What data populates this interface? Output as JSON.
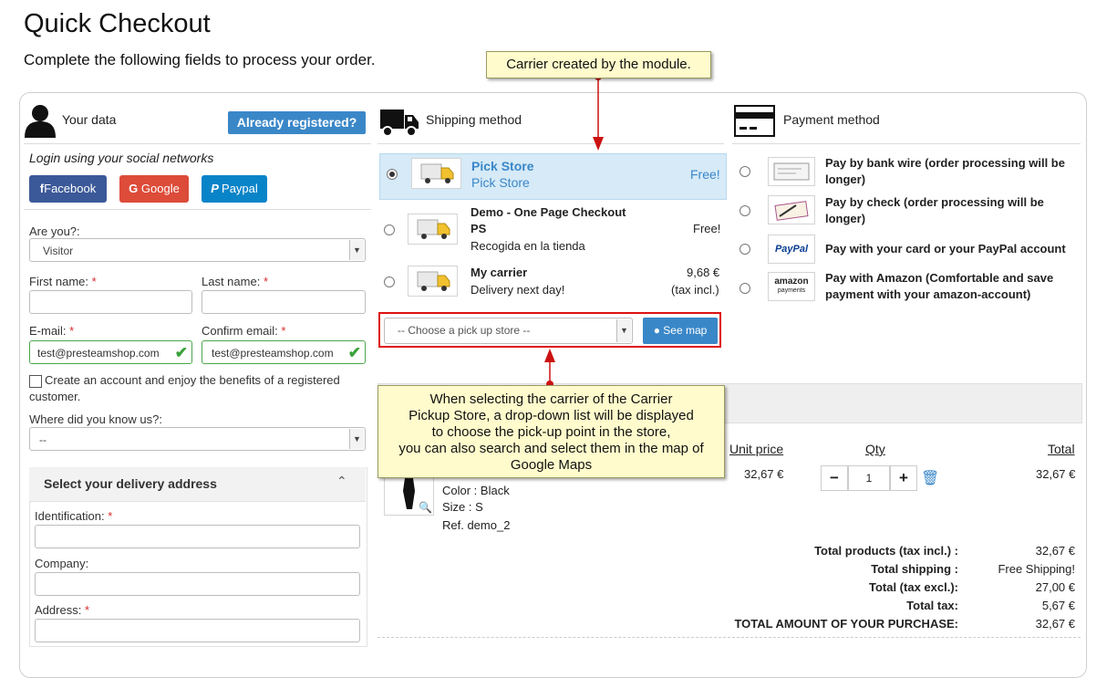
{
  "page": {
    "title": "Quick Checkout",
    "subtitle": "Complete the following fields to process your order."
  },
  "tooltips": {
    "top": "Carrier created by the module.",
    "bottom_lines": [
      "When selecting the carrier of the Carrier",
      "Pickup Store, a drop-down list will be displayed",
      "to choose the pick-up point in the store,",
      "you can also search and select them in the map of",
      "Google Maps"
    ]
  },
  "your_data": {
    "title": "Your data",
    "already_registered": "Already registered?",
    "social_title": "Login using your social networks",
    "social": [
      "Facebook",
      "Google",
      "Paypal"
    ],
    "are_you_label": "Are you?:",
    "are_you_value": "Visitor",
    "first_name_label": "First name:",
    "last_name_label": "Last name:",
    "email_label": "E-mail:",
    "confirm_email_label": "Confirm email:",
    "email_value": "test@presteamshop.com",
    "confirm_email_value": "test@presteamshop.com",
    "create_account_line1": "Create an account and enjoy the benefits of a registered",
    "create_account_line2": "customer.",
    "where_label": "Where did you know us?:",
    "where_value": "--",
    "required_mark": "*",
    "delivery_title": "Select your delivery address",
    "identification_label": "Identification:",
    "company_label": "Company:",
    "address_label": "Address:"
  },
  "shipping": {
    "title": "Shipping method",
    "carriers": [
      {
        "name": "Pick Store",
        "desc": "Pick Store",
        "price": "Free!",
        "price2": ""
      },
      {
        "name": "Demo - One Page Checkout",
        "name2": "PS",
        "desc": "Recogida en la tienda",
        "price": "Free!",
        "price2": ""
      },
      {
        "name": "My carrier",
        "desc": "Delivery next day!",
        "price": "9,68 €",
        "price2": "(tax incl.)"
      }
    ],
    "pickup_placeholder": "-- Choose a pick up store --",
    "see_map": "See map"
  },
  "payment": {
    "title": "Payment method",
    "methods": [
      {
        "line1": "Pay by bank wire (order processing will be",
        "line2": "longer)"
      },
      {
        "line1": "Pay by check (order processing will be",
        "line2": "longer)"
      },
      {
        "line1": "Pay with your card or your PayPal account",
        "line2": ""
      },
      {
        "line1": "Pay with Amazon (Comfortable and save",
        "line2": "payment with your amazon-account)"
      }
    ],
    "logos": [
      "PayPal",
      "amazon",
      "payments"
    ]
  },
  "cart": {
    "headers": {
      "unit_price": "Unit price",
      "qty": "Qty",
      "total": "Total"
    },
    "item": {
      "color": "Color : Black",
      "size": "Size : S",
      "ref": "Ref. demo_2",
      "unit_price": "32,67 €",
      "qty": "1",
      "total": "32,67 €"
    },
    "totals": [
      {
        "label": "Total products  (tax incl.) :",
        "value": "32,67 €"
      },
      {
        "label": "Total shipping :",
        "value": "Free Shipping!"
      },
      {
        "label": "Total  (tax excl.):",
        "value": "27,00 €"
      },
      {
        "label": "Total tax:",
        "value": "5,67 €"
      },
      {
        "label": "TOTAL AMOUNT OF YOUR PURCHASE:",
        "value": "32,67 €"
      }
    ]
  },
  "colors": {
    "accent": "#3a87c8",
    "facebook": "#3b5998",
    "google": "#dd4b39",
    "paypal": "#0a84c8",
    "selected_carrier": "#d6eaf7",
    "tooltip": "#fffbcc",
    "callout_red": "#d11111"
  }
}
